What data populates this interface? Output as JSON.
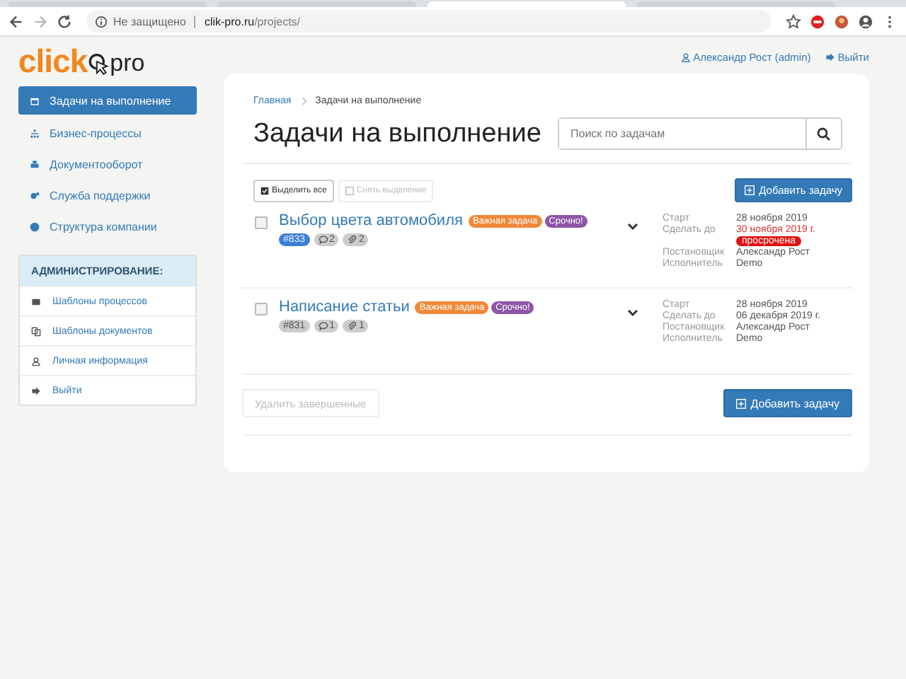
{
  "browser_tabs": [
    {
      "selected": false
    },
    {
      "selected": false
    },
    {
      "selected": true
    },
    {
      "selected": false
    }
  ],
  "browser": {
    "security": "Не защищено",
    "url_host": "clik-pro.ru",
    "url_path": "/projects/"
  },
  "header": {
    "logo_main": "click",
    "logo_tail": "pro",
    "user": "Александр Рост (admin)",
    "logout": "Выйти"
  },
  "sidebar": {
    "items": [
      {
        "label": "Задачи на выполнение",
        "selected": true
      },
      {
        "label": "Бизнес-процессы",
        "selected": false
      },
      {
        "label": "Документооборот",
        "selected": false
      },
      {
        "label": "Служба поддержки",
        "selected": false
      },
      {
        "label": "Структура компании",
        "selected": false
      }
    ],
    "admin": {
      "title": "АДМИНИСТРИРОВАНИЕ:",
      "items": [
        {
          "label": "Шаблоны процессов"
        },
        {
          "label": "Шаблоны документов"
        },
        {
          "label": "Личная информация"
        },
        {
          "label": "Выйти"
        }
      ]
    }
  },
  "breadcrumbs": [
    {
      "label": "Главная",
      "kind": "link"
    },
    {
      "label": "Задачи на выполнение",
      "kind": "current"
    }
  ],
  "title": "Задачи на выполнение",
  "search": {
    "placeholder": "Поиск по задачам"
  },
  "select_all": {
    "label": "Выделить все",
    "disabled": false
  },
  "deselect": {
    "label": "Снять выделение",
    "disabled": true
  },
  "add_button": "Добавить задачу",
  "tasks": [
    {
      "title": "Выбор цвета автомобиля",
      "checked": false,
      "tags": [
        {
          "label": "Важная задача",
          "color": "#f0883a"
        },
        {
          "label": "Срочно!",
          "color": "#8e55a8"
        }
      ],
      "id": "#833",
      "id_highlighted": true,
      "comments": "2",
      "files": "2",
      "fields": [
        {
          "label": "Старт",
          "value": "28 ноября 2019",
          "overdue": false
        },
        {
          "label": "Сделать до",
          "value": "30 ноября 2019 г.",
          "overdue": true,
          "badge": "просрочена"
        },
        {
          "label": "Постановщик",
          "value": "Александр Рост",
          "overdue": false
        },
        {
          "label": "Исполнитель",
          "value": "Demo",
          "overdue": false
        }
      ]
    },
    {
      "title": "Написание статьи",
      "checked": false,
      "tags": [
        {
          "label": "Важная задача",
          "color": "#f0883a"
        },
        {
          "label": "Срочно!",
          "color": "#8e55a8"
        }
      ],
      "id": "#831",
      "id_highlighted": false,
      "comments": "1",
      "files": "1",
      "fields": [
        {
          "label": "Старт",
          "value": "28 ноября 2019",
          "overdue": false
        },
        {
          "label": "Сделать до",
          "value": "06 декабря 2019 г.",
          "overdue": false
        },
        {
          "label": "Постановщик",
          "value": "Александр Рост",
          "overdue": false
        },
        {
          "label": "Исполнитель",
          "value": "Demo",
          "overdue": false
        }
      ]
    }
  ],
  "delete_done": {
    "label": "Удалить завершенные",
    "disabled": true
  },
  "add_button_bottom": "Добавить задачу"
}
